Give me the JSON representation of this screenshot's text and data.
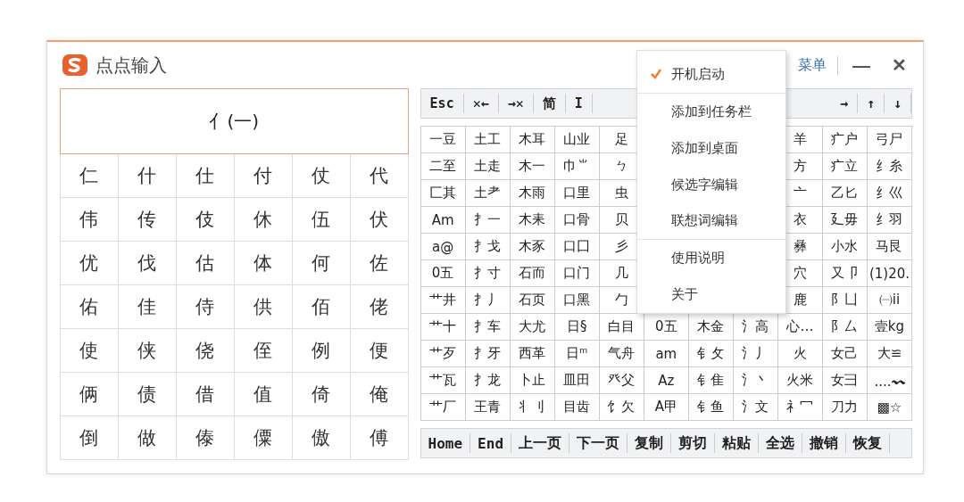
{
  "window": {
    "title": "点点输入",
    "menu_link": "菜单",
    "minimize": "—",
    "close": "✕"
  },
  "radical_header": "亻(一)",
  "characters": [
    [
      "仁",
      "什",
      "仕",
      "付",
      "仗",
      "代"
    ],
    [
      "伟",
      "传",
      "伎",
      "休",
      "伍",
      "伏"
    ],
    [
      "优",
      "伐",
      "估",
      "体",
      "何",
      "佐"
    ],
    [
      "佑",
      "佳",
      "侍",
      "供",
      "佰",
      "佬"
    ],
    [
      "使",
      "侠",
      "侥",
      "侄",
      "例",
      "便"
    ],
    [
      "俩",
      "债",
      "借",
      "值",
      "倚",
      "俺"
    ],
    [
      "倒",
      "做",
      "傣",
      "僳",
      "傲",
      "傅"
    ]
  ],
  "toolbar": {
    "left": [
      "Esc",
      "✕←",
      "→✕",
      "简",
      "I"
    ],
    "right": [
      "→",
      "↑",
      "↓"
    ]
  },
  "component_rows": [
    [
      "一豆",
      "土工",
      "木耳",
      "山业",
      "足",
      "羊",
      "疒户",
      "弓尸"
    ],
    [
      "二至",
      "土走",
      "木一",
      "巾⺌",
      "ㄅ",
      "方",
      "疒立",
      "纟糸"
    ],
    [
      "匚其",
      "土耂",
      "木雨",
      "口里",
      "虫",
      "亠",
      "乙匕",
      "纟巛"
    ],
    [
      "Am",
      "扌一",
      "木耒",
      "口骨",
      "贝",
      "衣",
      "廴毋",
      "纟羽"
    ],
    [
      "a@",
      "扌戈",
      "木豕",
      "口囗",
      "彡",
      "彝",
      "小水",
      "马艮"
    ],
    [
      "0五",
      "扌寸",
      "石而",
      "口门",
      "几",
      "穴",
      "又卩",
      "(1)20."
    ],
    [
      "艹井",
      "扌丿",
      "石页",
      "口黑",
      "勹",
      "鹿",
      "阝凵",
      "㈠ii"
    ],
    [
      "艹十",
      "扌车",
      "大尤",
      "日§",
      "白目",
      "0五",
      "木金",
      "氵高",
      "心…",
      "阝厶",
      "壹kg"
    ],
    [
      "艹歹",
      "扌牙",
      "西革",
      "日ᵐ",
      "气舟",
      "am",
      "钅攵",
      "氵丿",
      "火",
      "女己",
      "大≌"
    ],
    [
      "艹瓦",
      "扌龙",
      "卜止",
      "皿田",
      "癶父",
      "Az",
      "钅隹",
      "氵丶",
      "火米",
      "女彐",
      "....〰"
    ],
    [
      "艹厂",
      "王青",
      "丬刂",
      "目齿",
      "饣欠",
      "A甲",
      "钅鱼",
      "氵文",
      "礻冖",
      "刀力",
      "▩☆"
    ]
  ],
  "bottom_bar": [
    "Home",
    "End",
    "上一页",
    "下一页",
    "复制",
    "剪切",
    "粘贴",
    "全选",
    "撤销",
    "恢复"
  ],
  "context_menu": [
    {
      "label": "开机启动",
      "checked": true
    },
    {
      "label": "添加到任务栏",
      "checked": false,
      "separator_before": true
    },
    {
      "label": "添加到桌面",
      "checked": false
    },
    {
      "label": "候选字编辑",
      "checked": false
    },
    {
      "label": "联想词编辑",
      "checked": false
    },
    {
      "label": "使用说明",
      "checked": false,
      "separator_before": true
    },
    {
      "label": "关于",
      "checked": false
    }
  ]
}
